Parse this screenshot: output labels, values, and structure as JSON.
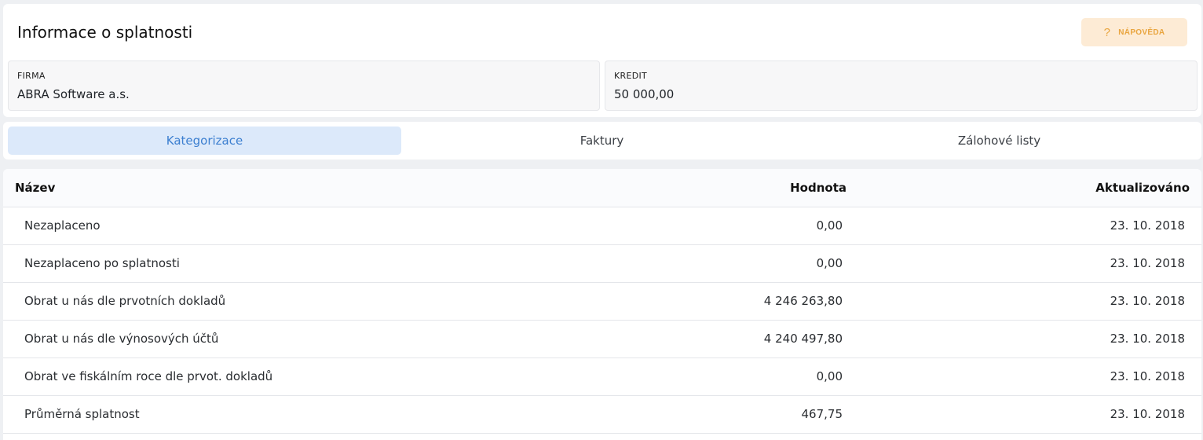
{
  "header": {
    "title": "Informace o splatnosti",
    "help_label": "NÁPOVĚDA",
    "help_icon": "?"
  },
  "info": {
    "firma_label": "FIRMA",
    "firma_value": "ABRA Software a.s.",
    "kredit_label": "KREDIT",
    "kredit_value": "50 000,00"
  },
  "tabs": [
    {
      "label": "Kategorizace",
      "active": true
    },
    {
      "label": "Faktury",
      "active": false
    },
    {
      "label": "Zálohové listy",
      "active": false
    }
  ],
  "table": {
    "columns": [
      "Název",
      "Hodnota",
      "Aktualizováno"
    ],
    "rows": [
      [
        "Nezaplaceno",
        "0,00",
        "23. 10. 2018"
      ],
      [
        "Nezaplaceno po splatnosti",
        "0,00",
        "23. 10. 2018"
      ],
      [
        "Obrat u nás dle prvotních dokladů",
        "4 246 263,80",
        "23. 10. 2018"
      ],
      [
        "Obrat u nás dle výnosových účtů",
        "4 240 497,80",
        "23. 10. 2018"
      ],
      [
        "Obrat ve fiskálním roce dle prvot. dokladů",
        "0,00",
        "23. 10. 2018"
      ],
      [
        "Průměrná splatnost",
        "467,75",
        "23. 10. 2018"
      ]
    ]
  },
  "colors": {
    "accent": "#3c7fd0",
    "tab_active_bg": "#dce9fa",
    "help_bg": "#fdebd5",
    "help_fg": "#e9a53f"
  }
}
